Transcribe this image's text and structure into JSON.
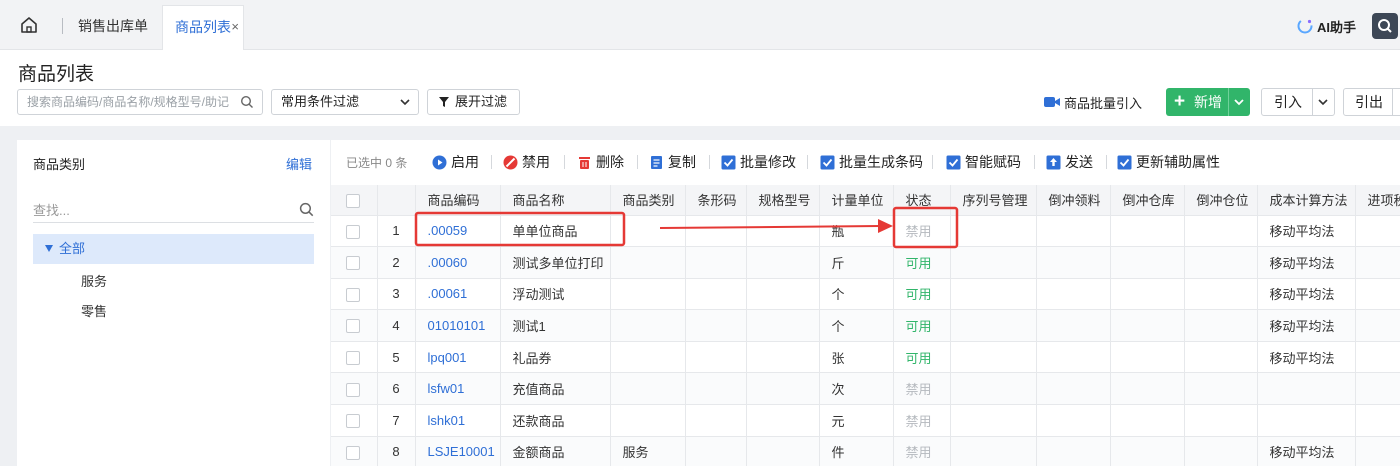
{
  "tabs": {
    "home_icon": "home-icon",
    "items": [
      {
        "label": "销售出库单"
      },
      {
        "label": "商品列表",
        "close": "×"
      }
    ],
    "ai_assistant": "AI助手"
  },
  "header": {
    "title": "商品列表",
    "search_placeholder": "搜索商品编码/商品名称/规格型号/助记",
    "filter_select": "常用条件过滤",
    "expand_filter": "展开过滤",
    "batch_import": "商品批量引入",
    "new_label": "新增",
    "import_label": "引入",
    "export_label": "引出"
  },
  "category_panel": {
    "title": "商品类别",
    "edit": "编辑",
    "search_placeholder": "查找...",
    "tree_root": "全部",
    "tree_children": [
      "服务",
      "零售"
    ]
  },
  "toolbar": {
    "selected": "已选中 0 条",
    "buttons": [
      "启用",
      "禁用",
      "删除",
      "复制",
      "批量修改",
      "批量生成条码",
      "智能赋码",
      "发送",
      "更新辅助属性"
    ]
  },
  "table": {
    "columns": [
      "",
      "",
      "商品编码",
      "商品名称",
      "商品类别",
      "条形码",
      "规格型号",
      "计量单位",
      "状态",
      "序列号管理",
      "倒冲领料",
      "倒冲仓库",
      "倒冲仓位",
      "成本计算方法",
      "进项税"
    ],
    "rows": [
      {
        "no": "1",
        "code": ".00059",
        "name": "单单位商品",
        "category": "",
        "barcode": "",
        "spec": "",
        "unit": "瓶",
        "status": "禁用",
        "cost": "移动平均法"
      },
      {
        "no": "2",
        "code": ".00060",
        "name": "测试多单位打印",
        "category": "",
        "barcode": "",
        "spec": "",
        "unit": "斤",
        "status": "可用",
        "cost": "移动平均法"
      },
      {
        "no": "3",
        "code": ".00061",
        "name": "浮动测试",
        "category": "",
        "barcode": "",
        "spec": "",
        "unit": "个",
        "status": "可用",
        "cost": "移动平均法"
      },
      {
        "no": "4",
        "code": "01010101",
        "name": "测试1",
        "category": "",
        "barcode": "",
        "spec": "",
        "unit": "个",
        "status": "可用",
        "cost": "移动平均法"
      },
      {
        "no": "5",
        "code": "lpq001",
        "name": "礼品券",
        "category": "",
        "barcode": "",
        "spec": "",
        "unit": "张",
        "status": "可用",
        "cost": "移动平均法"
      },
      {
        "no": "6",
        "code": "lsfw01",
        "name": "充值商品",
        "category": "",
        "barcode": "",
        "spec": "",
        "unit": "次",
        "status": "禁用",
        "cost": ""
      },
      {
        "no": "7",
        "code": "lshk01",
        "name": "还款商品",
        "category": "",
        "barcode": "",
        "spec": "",
        "unit": "元",
        "status": "禁用",
        "cost": ""
      },
      {
        "no": "8",
        "code": "LSJE10001",
        "name": "金额商品",
        "category": "服务",
        "barcode": "",
        "spec": "",
        "unit": "件",
        "status": "禁用",
        "cost": "移动平均法"
      }
    ]
  },
  "colors": {
    "accent_blue": "#2f6fd6",
    "primary_green": "#31b56a",
    "enabled_text": "#31b56a",
    "disabled_text": "#b5b9be",
    "annotation_red": "#e53935"
  }
}
